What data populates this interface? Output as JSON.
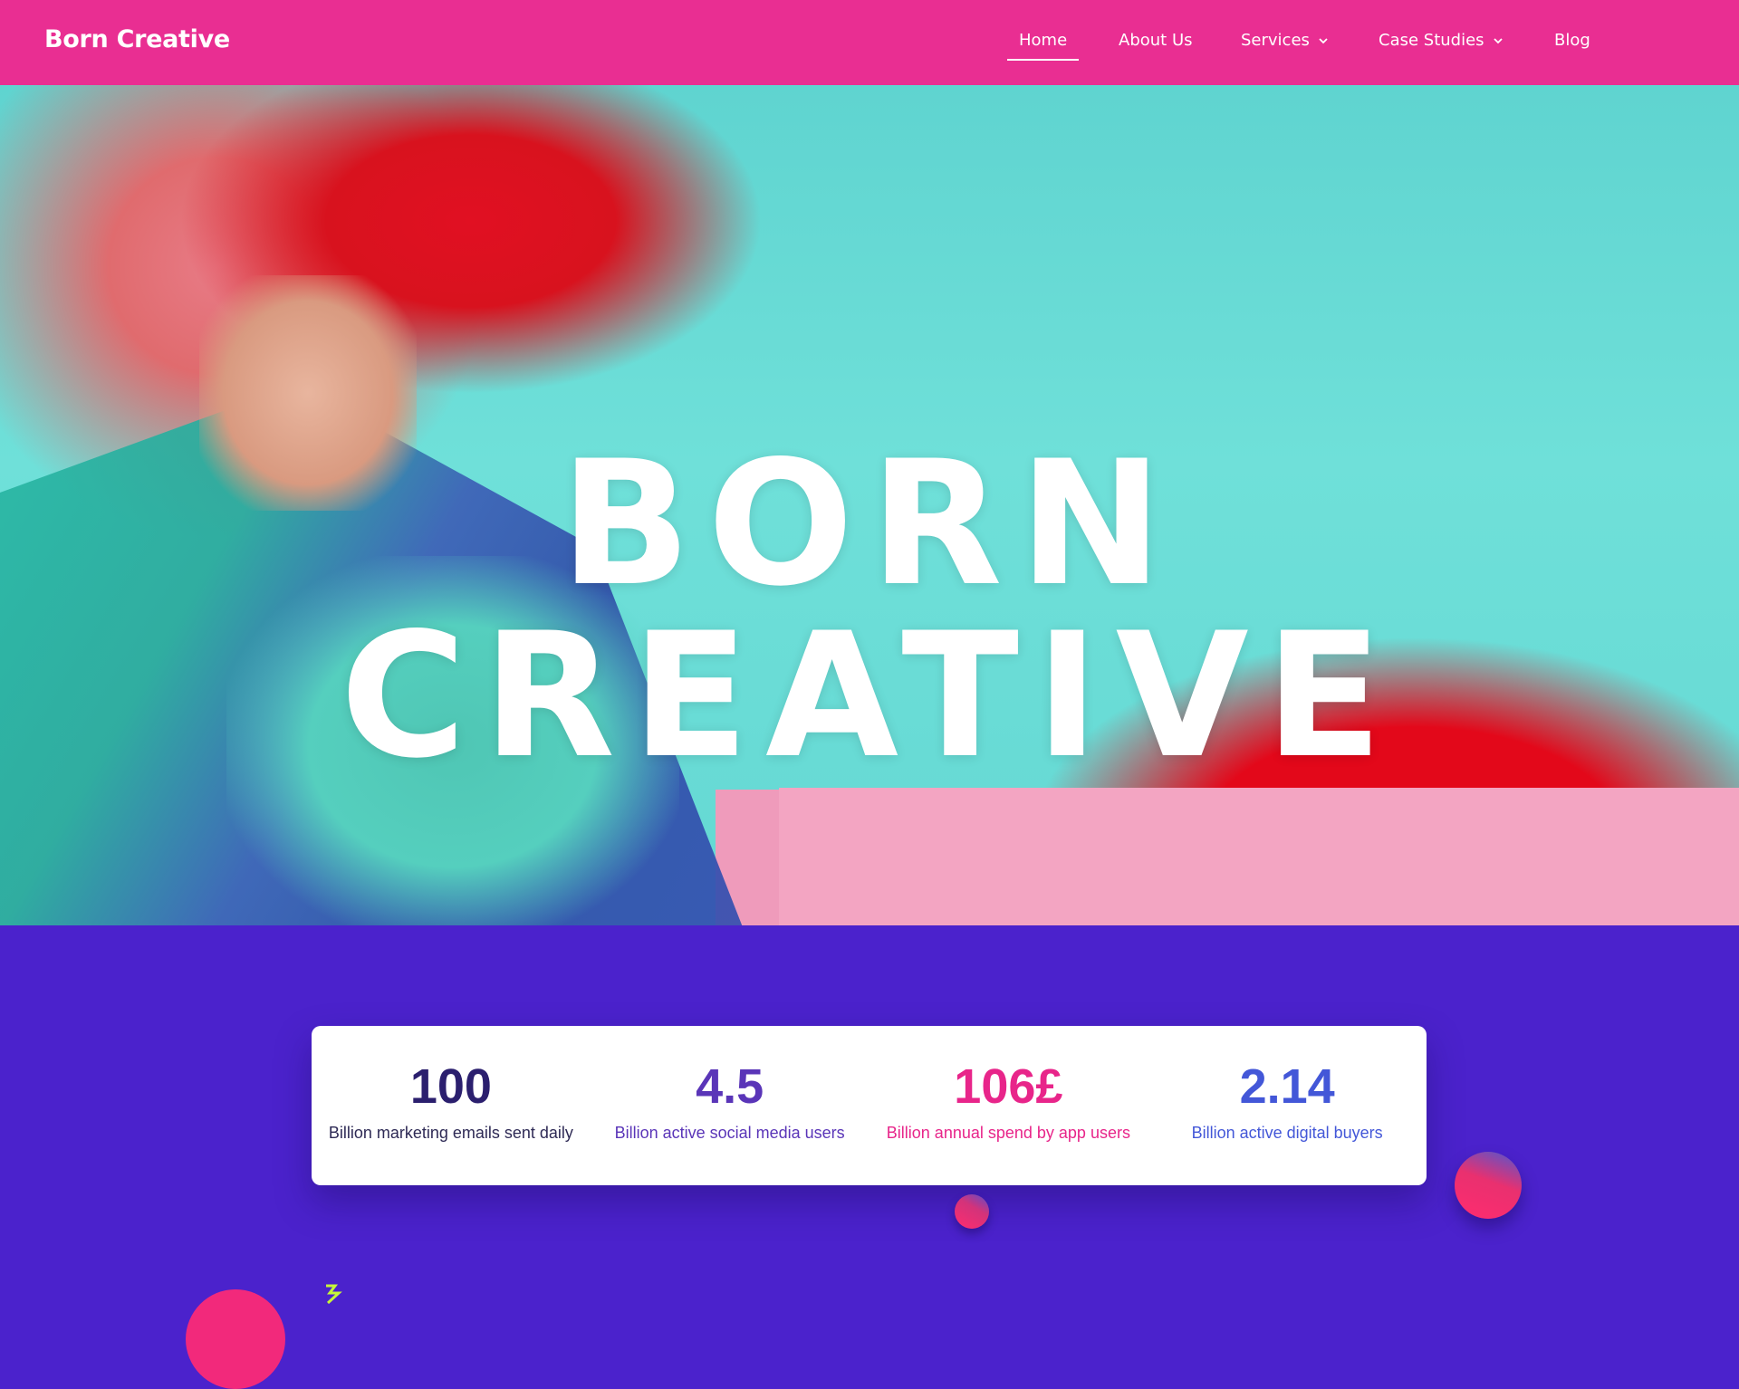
{
  "header": {
    "logo": "Born Creative",
    "nav": [
      {
        "label": "Home",
        "active": true,
        "dropdown": false
      },
      {
        "label": "About Us",
        "active": false,
        "dropdown": false
      },
      {
        "label": "Services",
        "active": false,
        "dropdown": true
      },
      {
        "label": "Case Studies",
        "active": false,
        "dropdown": true
      },
      {
        "label": "Blog",
        "active": false,
        "dropdown": false
      }
    ]
  },
  "hero": {
    "title": "BORN CREATIVE"
  },
  "stats": [
    {
      "value": "100",
      "label": "Billion marketing emails sent daily",
      "color": "#2b1f6e",
      "label_color": "#2e2a55"
    },
    {
      "value": "4.5",
      "label": "Billion active social media users",
      "color": "#5a35b8",
      "label_color": "#5a35b8"
    },
    {
      "value": "106£",
      "label": "Billion annual spend by app users",
      "color": "#e8258a",
      "label_color": "#e8258a"
    },
    {
      "value": "2.14",
      "label": "Billion active digital buyers",
      "color": "#4357d8",
      "label_color": "#4357d8"
    }
  ],
  "colors": {
    "header_bg": "#e92e92",
    "section_bg": "#4b22cc",
    "card_bg": "#ffffff"
  },
  "icons": [
    "chevron-down-icon",
    "lightning-icon"
  ]
}
